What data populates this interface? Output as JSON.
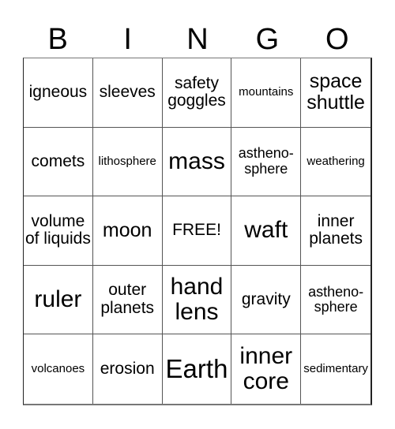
{
  "header": {
    "letters": [
      "B",
      "I",
      "N",
      "G",
      "O"
    ]
  },
  "cells": [
    "igneous",
    "sleeves",
    "safety goggles",
    "mountains",
    "space shuttle",
    "comets",
    "lithosphere",
    "mass",
    "astheno-\nsphere",
    "weathering",
    "volume of liquids",
    "moon",
    "FREE!",
    "waft",
    "inner planets",
    "ruler",
    "outer planets",
    "hand lens",
    "gravity",
    "astheno-\nsphere",
    "volcanoes",
    "erosion",
    "Earth",
    "inner core",
    "sedimentary"
  ]
}
